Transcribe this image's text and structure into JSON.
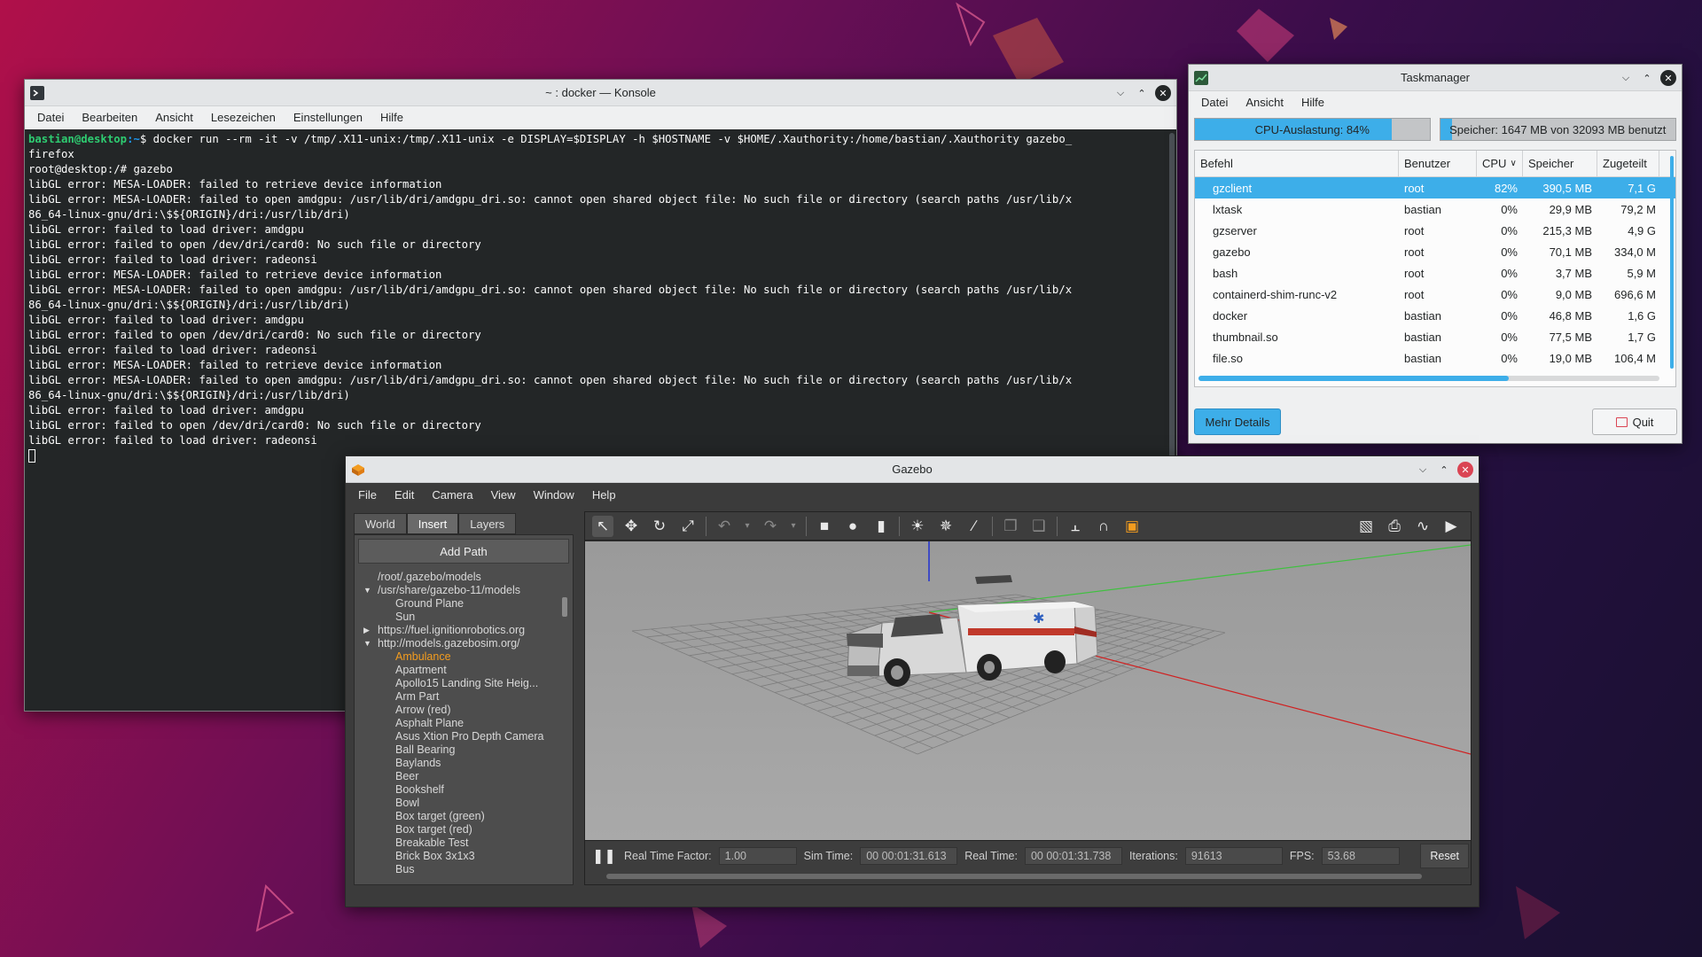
{
  "konsole": {
    "title": "~ : docker — Konsole",
    "menu": [
      "Datei",
      "Bearbeiten",
      "Ansicht",
      "Lesezeichen",
      "Einstellungen",
      "Hilfe"
    ],
    "prompt_user": "bastian@desktop",
    "prompt_path": ":~",
    "prompt_symbol": "$",
    "command": " docker run --rm -it -v /tmp/.X11-unix:/tmp/.X11-unix -e DISPLAY=$DISPLAY -h $HOSTNAME -v $HOME/.Xauthority:/home/bastian/.Xauthority gazebo_",
    "lines": [
      "firefox",
      "root@desktop:/# gazebo",
      "libGL error: MESA-LOADER: failed to retrieve device information",
      "libGL error: MESA-LOADER: failed to open amdgpu: /usr/lib/dri/amdgpu_dri.so: cannot open shared object file: No such file or directory (search paths /usr/lib/x",
      "86_64-linux-gnu/dri:\\$${ORIGIN}/dri:/usr/lib/dri)",
      "libGL error: failed to load driver: amdgpu",
      "libGL error: failed to open /dev/dri/card0: No such file or directory",
      "libGL error: failed to load driver: radeonsi",
      "libGL error: MESA-LOADER: failed to retrieve device information",
      "libGL error: MESA-LOADER: failed to open amdgpu: /usr/lib/dri/amdgpu_dri.so: cannot open shared object file: No such file or directory (search paths /usr/lib/x",
      "86_64-linux-gnu/dri:\\$${ORIGIN}/dri:/usr/lib/dri)",
      "libGL error: failed to load driver: amdgpu",
      "libGL error: failed to open /dev/dri/card0: No such file or directory",
      "libGL error: failed to load driver: radeonsi",
      "libGL error: MESA-LOADER: failed to retrieve device information",
      "libGL error: MESA-LOADER: failed to open amdgpu: /usr/lib/dri/amdgpu_dri.so: cannot open shared object file: No such file or directory (search paths /usr/lib/x",
      "86_64-linux-gnu/dri:\\$${ORIGIN}/dri:/usr/lib/dri)",
      "libGL error: failed to load driver: amdgpu",
      "libGL error: failed to open /dev/dri/card0: No such file or directory",
      "libGL error: failed to load driver: radeonsi"
    ]
  },
  "taskman": {
    "title": "Taskmanager",
    "menu": [
      "Datei",
      "Ansicht",
      "Hilfe"
    ],
    "cpu_label": "CPU-Auslastung: 84%",
    "cpu_fraction": 0.84,
    "mem_label": "Speicher: 1647 MB von 32093 MB benutzt",
    "mem_fraction": 0.05,
    "columns": [
      "Befehl",
      "Benutzer",
      "CPU",
      "Speicher",
      "Zugeteilt"
    ],
    "rows": [
      [
        "gzclient",
        "root",
        "82%",
        "390,5 MB",
        "7,1 G"
      ],
      [
        "lxtask",
        "bastian",
        "0%",
        "29,9 MB",
        "79,2 M"
      ],
      [
        "gzserver",
        "root",
        "0%",
        "215,3 MB",
        "4,9 G"
      ],
      [
        "gazebo",
        "root",
        "0%",
        "70,1 MB",
        "334,0 M"
      ],
      [
        "bash",
        "root",
        "0%",
        "3,7 MB",
        "5,9 M"
      ],
      [
        "containerd-shim-runc-v2",
        "root",
        "0%",
        "9,0 MB",
        "696,6 M"
      ],
      [
        "docker",
        "bastian",
        "0%",
        "46,8 MB",
        "1,6 G"
      ],
      [
        "thumbnail.so",
        "bastian",
        "0%",
        "77,5 MB",
        "1,7 G"
      ],
      [
        "file.so",
        "bastian",
        "0%",
        "19,0 MB",
        "106,4 M"
      ]
    ],
    "more_details": "Mehr Details",
    "quit": "Quit"
  },
  "gazebo": {
    "title": "Gazebo",
    "menu": [
      "File",
      "Edit",
      "Camera",
      "View",
      "Window",
      "Help"
    ],
    "tabs": [
      "World",
      "Insert",
      "Layers"
    ],
    "active_tab": "Insert",
    "add_path": "Add Path",
    "tree": [
      {
        "text": "/root/.gazebo/models",
        "level": 0,
        "arrow": ""
      },
      {
        "text": "/usr/share/gazebo-11/models",
        "level": 0,
        "arrow": "down"
      },
      {
        "text": "Ground Plane",
        "level": 1
      },
      {
        "text": "Sun",
        "level": 1
      },
      {
        "text": "https://fuel.ignitionrobotics.org",
        "level": 0,
        "arrow": "right"
      },
      {
        "text": "http://models.gazebosim.org/",
        "level": 0,
        "arrow": "down"
      },
      {
        "text": "Ambulance",
        "level": 1,
        "highlight": true
      },
      {
        "text": "Apartment",
        "level": 1
      },
      {
        "text": "Apollo15 Landing Site Heig...",
        "level": 1
      },
      {
        "text": "Arm Part",
        "level": 1
      },
      {
        "text": "Arrow (red)",
        "level": 1
      },
      {
        "text": "Asphalt Plane",
        "level": 1
      },
      {
        "text": "Asus Xtion Pro Depth Camera",
        "level": 1
      },
      {
        "text": "Ball Bearing",
        "level": 1
      },
      {
        "text": "Baylands",
        "level": 1
      },
      {
        "text": "Beer",
        "level": 1
      },
      {
        "text": "Bookshelf",
        "level": 1
      },
      {
        "text": "Bowl",
        "level": 1
      },
      {
        "text": "Box target (green)",
        "level": 1
      },
      {
        "text": "Box target (red)",
        "level": 1
      },
      {
        "text": "Breakable Test",
        "level": 1
      },
      {
        "text": "Brick Box 3x1x3",
        "level": 1
      },
      {
        "text": "Bus",
        "level": 1
      }
    ],
    "stats": {
      "rtf_label": "Real Time Factor:",
      "rtf": "1.00",
      "sim_label": "Sim Time:",
      "sim": "00 00:01:31.613",
      "real_label": "Real Time:",
      "real": "00 00:01:31.738",
      "iter_label": "Iterations:",
      "iter": "91613",
      "fps_label": "FPS:",
      "fps": "53.68"
    },
    "reset": "Reset"
  }
}
